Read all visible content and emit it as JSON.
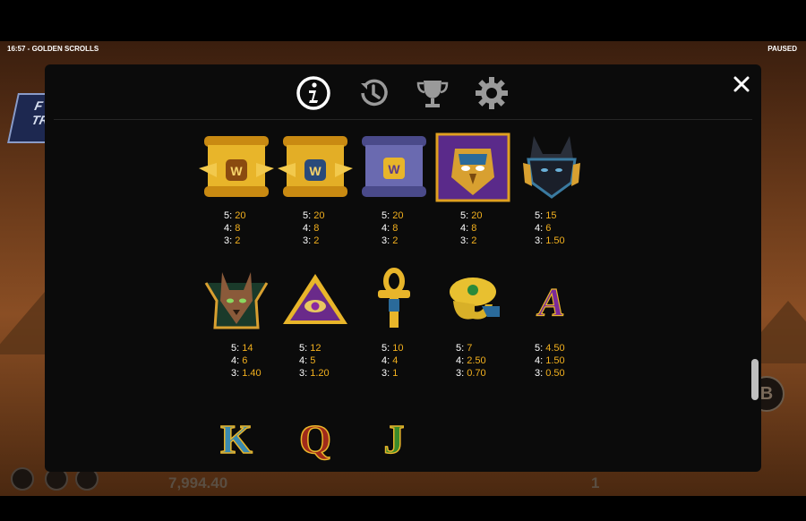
{
  "header": {
    "time_title": "16:57 - GOLDEN SCROLLS",
    "status": "PAUSED"
  },
  "background": {
    "balance": "7,994.40",
    "bet": "1",
    "side_tag": "F TRA",
    "round_button": "B"
  },
  "tabs": [
    {
      "name": "info-icon",
      "active": true
    },
    {
      "name": "history-icon",
      "active": false
    },
    {
      "name": "trophy-icon",
      "active": false
    },
    {
      "name": "settings-icon",
      "active": false
    }
  ],
  "close_label": "✕",
  "colors": {
    "payout_value": "#f2b01e",
    "active_tab": "#ffffff",
    "inactive_tab": "#9a9a9a",
    "panel_bg": "#0b0b0b"
  },
  "symbols_row1": [
    {
      "name": "gold-scroll-wild-1",
      "pays": [
        [
          "5:",
          "20"
        ],
        [
          "4:",
          "8"
        ],
        [
          "3:",
          "2"
        ]
      ]
    },
    {
      "name": "gold-scroll-wild-2",
      "pays": [
        [
          "5:",
          "20"
        ],
        [
          "4:",
          "8"
        ],
        [
          "3:",
          "2"
        ]
      ]
    },
    {
      "name": "purple-scroll-wild",
      "pays": [
        [
          "5:",
          "20"
        ],
        [
          "4:",
          "8"
        ],
        [
          "3:",
          "2"
        ]
      ]
    },
    {
      "name": "horus-falcon",
      "pays": [
        [
          "5:",
          "20"
        ],
        [
          "4:",
          "8"
        ],
        [
          "3:",
          "2"
        ]
      ]
    },
    {
      "name": "anubis-jackal",
      "pays": [
        [
          "5:",
          "15"
        ],
        [
          "4:",
          "6"
        ],
        [
          "3:",
          "1.50"
        ]
      ]
    }
  ],
  "symbols_row2": [
    {
      "name": "bastet-cat",
      "pays": [
        [
          "5:",
          "14"
        ],
        [
          "4:",
          "6"
        ],
        [
          "3:",
          "1.40"
        ]
      ]
    },
    {
      "name": "eye-pyramid",
      "pays": [
        [
          "5:",
          "12"
        ],
        [
          "4:",
          "5"
        ],
        [
          "3:",
          "1.20"
        ]
      ]
    },
    {
      "name": "ankh",
      "pays": [
        [
          "5:",
          "10"
        ],
        [
          "4:",
          "4"
        ],
        [
          "3:",
          "1"
        ]
      ]
    },
    {
      "name": "scarab",
      "pays": [
        [
          "5:",
          "7"
        ],
        [
          "4:",
          "2.50"
        ],
        [
          "3:",
          "0.70"
        ]
      ]
    },
    {
      "name": "letter-a",
      "pays": [
        [
          "5:",
          "4.50"
        ],
        [
          "4:",
          "1.50"
        ],
        [
          "3:",
          "0.50"
        ]
      ]
    }
  ],
  "symbols_row3": [
    {
      "name": "letter-k",
      "glyph": "K"
    },
    {
      "name": "letter-q",
      "glyph": "Q"
    },
    {
      "name": "letter-j",
      "glyph": "J"
    }
  ]
}
